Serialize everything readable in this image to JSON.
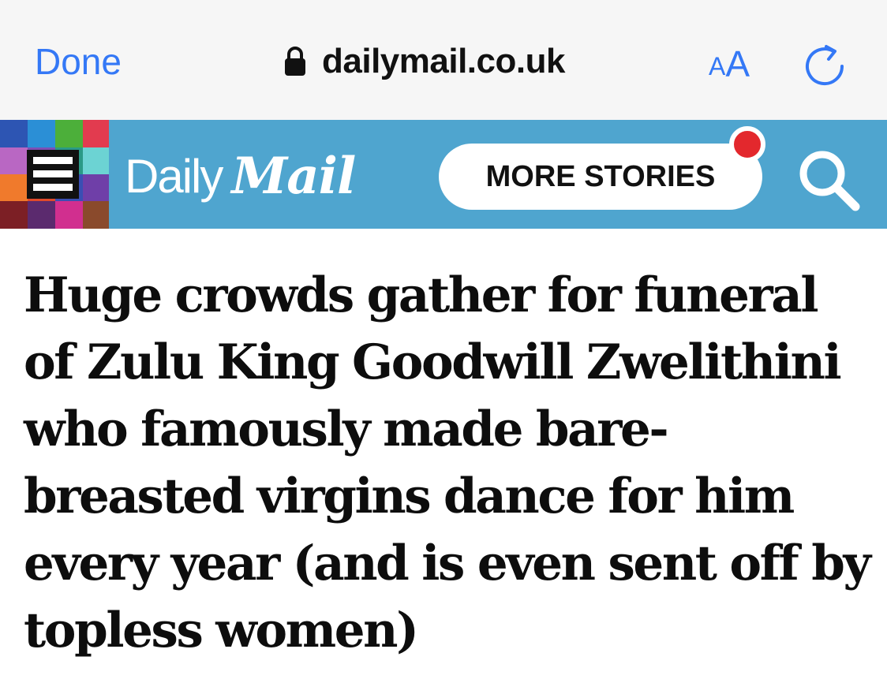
{
  "browser": {
    "done_label": "Done",
    "url": "dailymail.co.uk",
    "text_size_small": "A",
    "text_size_large": "A",
    "icons": {
      "lock": "lock-icon",
      "reload": "reload-icon"
    },
    "accent_color": "#3478f6"
  },
  "site_header": {
    "logo_daily": "Daily",
    "logo_mail": "Mail",
    "more_stories_label": "MORE STORIES",
    "background_color": "#4fa5cf",
    "notification_dot_color": "#e3282d",
    "icons": {
      "menu": "hamburger-menu-icon",
      "search": "search-icon"
    }
  },
  "article": {
    "headline": "Huge crowds gather for funeral of Zulu King Goodwill Zwelithini who famously made bare-breasted virgins dance for him every year (and is even sent off by topless women)"
  }
}
